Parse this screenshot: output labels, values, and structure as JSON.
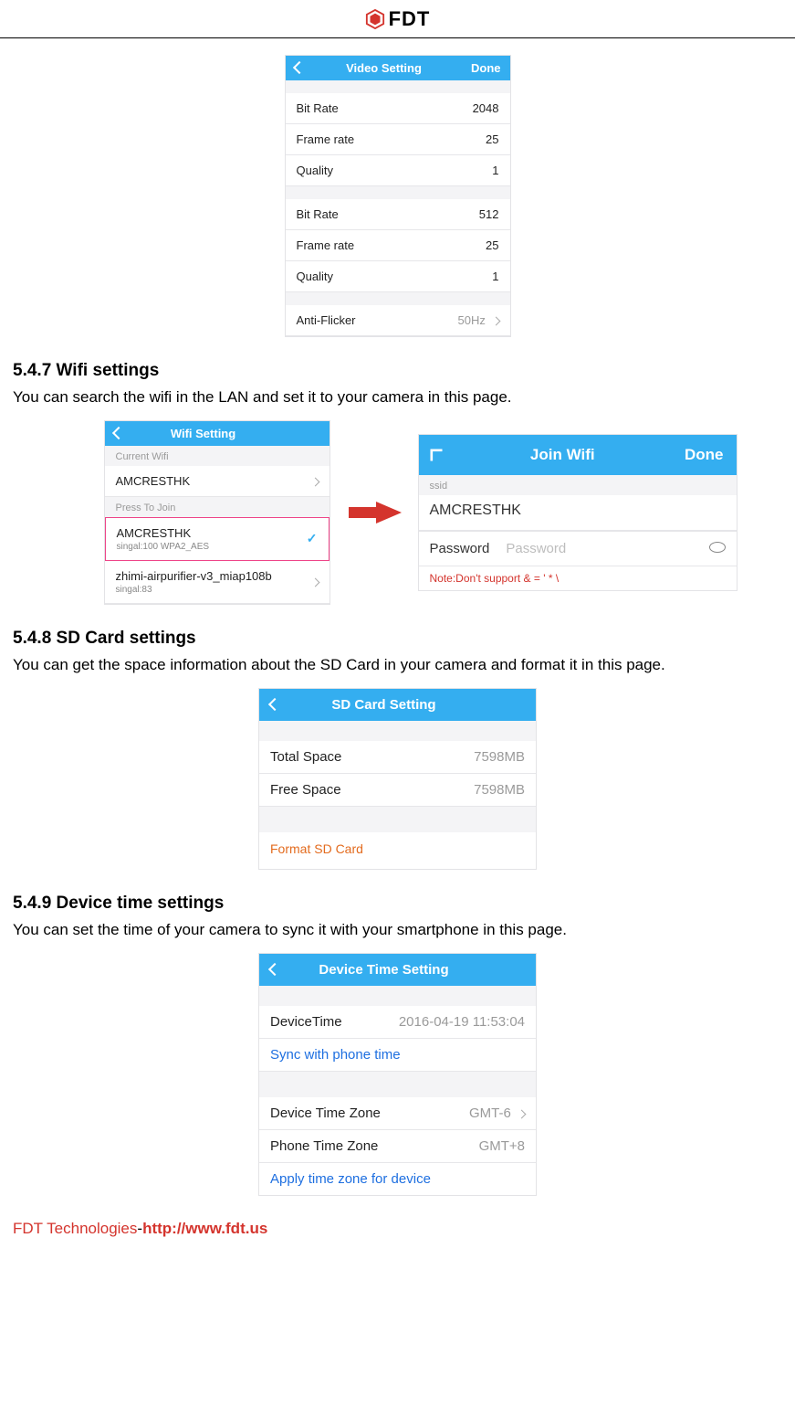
{
  "header": {
    "brand": "FDT"
  },
  "video_setting_panel": {
    "title": "Video Setting",
    "done": "Done",
    "group1": {
      "bit_rate_label": "Bit Rate",
      "bit_rate_value": "2048",
      "frame_rate_label": "Frame rate",
      "frame_rate_value": "25",
      "quality_label": "Quality",
      "quality_value": "1"
    },
    "group2": {
      "bit_rate_label": "Bit Rate",
      "bit_rate_value": "512",
      "frame_rate_label": "Frame rate",
      "frame_rate_value": "25",
      "quality_label": "Quality",
      "quality_value": "1"
    },
    "anti_flicker_label": "Anti-Flicker",
    "anti_flicker_value": "50Hz"
  },
  "section_547": {
    "heading": "5.4.7 Wifi settings",
    "text": "You can search the wifi in the LAN and set it to your camera in this page."
  },
  "wifi_list_panel": {
    "title": "Wifi Setting",
    "current_label": "Current Wifi",
    "current_ssid": "AMCRESTHK",
    "press_label": "Press To Join",
    "sel_ssid": "AMCRESTHK",
    "sel_sub": "singal:100    WPA2_AES",
    "other_ssid": "zhimi-airpurifier-v3_miap108b",
    "other_sub": "singal:83"
  },
  "join_wifi_panel": {
    "title": "Join Wifi",
    "done": "Done",
    "ssid_label": "ssid",
    "ssid_value": "AMCRESTHK",
    "password_label": "Password",
    "password_placeholder": "Password",
    "note": "Note:Don't support & = ' * \\"
  },
  "section_548": {
    "heading": "5.4.8 SD Card settings",
    "text": "You can get the space information about the SD Card in your camera and format it in this page."
  },
  "sd_panel": {
    "title": "SD Card Setting",
    "total_label": "Total Space",
    "total_value": "7598MB",
    "free_label": "Free Space",
    "free_value": "7598MB",
    "format_label": "Format SD Card"
  },
  "section_549": {
    "heading": "5.4.9 Device time settings",
    "text": "You can set the time of your camera to sync it with your smartphone in this page."
  },
  "time_panel": {
    "title": "Device Time Setting",
    "device_time_label": "DeviceTime",
    "device_time_value": "2016-04-19  11:53:04",
    "sync_label": "Sync with phone time",
    "device_tz_label": "Device Time Zone",
    "device_tz_value": "GMT-6",
    "phone_tz_label": "Phone Time Zone",
    "phone_tz_value": "GMT+8",
    "apply_label": "Apply time zone for device"
  },
  "footer": {
    "company": "FDT Technologies",
    "dash": "-",
    "url": "http://www.fdt.us"
  }
}
